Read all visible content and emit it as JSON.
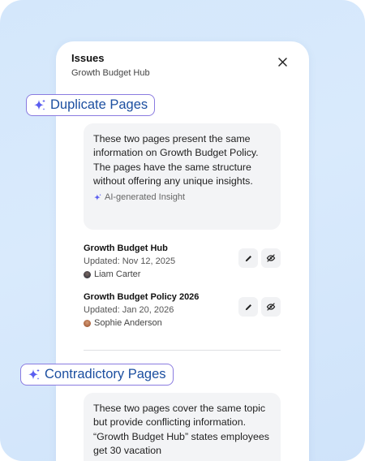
{
  "panel": {
    "title": "Issues",
    "subtitle": "Growth Budget Hub"
  },
  "sections": [
    {
      "tag": "Duplicate Pages",
      "insight": "These two pages present the same information on Growth Budget Policy. The pages have the same structure without offering any unique insights.",
      "ai_label": "AI-generated Insight",
      "pages": [
        {
          "name": "Growth Budget Hub",
          "updated": "Updated: Nov 12, 2025",
          "author": "Liam Carter"
        },
        {
          "name": "Growth Budget Policy 2026",
          "updated": "Updated: Jan 20, 2026",
          "author": "Sophie Anderson"
        }
      ]
    },
    {
      "tag": "Contradictory Pages",
      "insight": "These two pages cover the same topic but provide conflicting information. “Growth Budget Hub” states employees get 30 vacation"
    }
  ],
  "icons": {
    "close": "close-icon",
    "sparkle": "sparkle-icon",
    "edit": "pencil-icon",
    "hide": "eye-off-icon"
  },
  "colors": {
    "tag_border": "#8a7be0",
    "tag_text": "#1c4fa0",
    "sparkle": "#5b5ef0",
    "background": "#d6e8fb"
  }
}
